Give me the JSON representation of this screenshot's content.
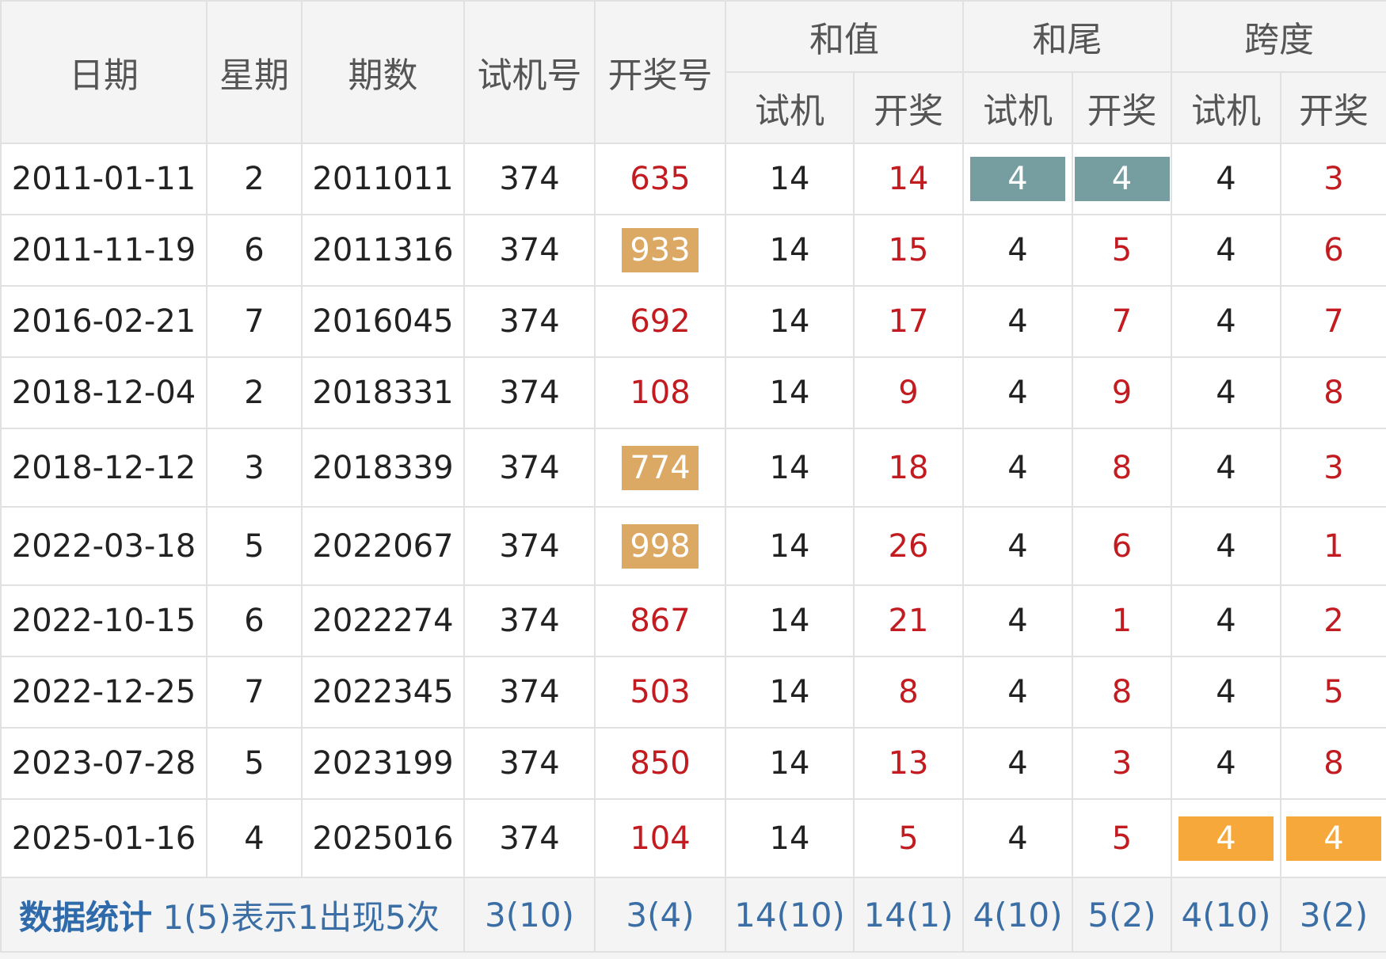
{
  "header": {
    "date": "日期",
    "weekday": "星期",
    "issue": "期数",
    "trial_number": "试机号",
    "draw_number": "开奖号",
    "sum_group": "和值",
    "tail_group": "和尾",
    "span_group": "跨度",
    "sub_trial": "试机",
    "sub_draw": "开奖"
  },
  "colors": {
    "red_text": "#c21b20",
    "tan_highlight": "#dca964",
    "teal_highlight": "#769ea0",
    "orange_highlight": "#f7a83a",
    "header_bg": "#f4f4f4",
    "stat_blue": "#2f6aaa"
  },
  "rows": [
    {
      "date": "2011-01-11",
      "weekday": "2",
      "issue": "2011011",
      "trial": "374",
      "draw": "635",
      "sum_trial": "14",
      "sum_draw": "14",
      "tail_trial": "4",
      "tail_draw": "4",
      "span_trial": "4",
      "span_draw": "3"
    },
    {
      "date": "2011-11-19",
      "weekday": "6",
      "issue": "2011316",
      "trial": "374",
      "draw": "933",
      "sum_trial": "14",
      "sum_draw": "15",
      "tail_trial": "4",
      "tail_draw": "5",
      "span_trial": "4",
      "span_draw": "6"
    },
    {
      "date": "2016-02-21",
      "weekday": "7",
      "issue": "2016045",
      "trial": "374",
      "draw": "692",
      "sum_trial": "14",
      "sum_draw": "17",
      "tail_trial": "4",
      "tail_draw": "7",
      "span_trial": "4",
      "span_draw": "7"
    },
    {
      "date": "2018-12-04",
      "weekday": "2",
      "issue": "2018331",
      "trial": "374",
      "draw": "108",
      "sum_trial": "14",
      "sum_draw": "9",
      "tail_trial": "4",
      "tail_draw": "9",
      "span_trial": "4",
      "span_draw": "8"
    },
    {
      "date": "2018-12-12",
      "weekday": "3",
      "issue": "2018339",
      "trial": "374",
      "draw": "774",
      "sum_trial": "14",
      "sum_draw": "18",
      "tail_trial": "4",
      "tail_draw": "8",
      "span_trial": "4",
      "span_draw": "3"
    },
    {
      "date": "2022-03-18",
      "weekday": "5",
      "issue": "2022067",
      "trial": "374",
      "draw": "998",
      "sum_trial": "14",
      "sum_draw": "26",
      "tail_trial": "4",
      "tail_draw": "6",
      "span_trial": "4",
      "span_draw": "1"
    },
    {
      "date": "2022-10-15",
      "weekday": "6",
      "issue": "2022274",
      "trial": "374",
      "draw": "867",
      "sum_trial": "14",
      "sum_draw": "21",
      "tail_trial": "4",
      "tail_draw": "1",
      "span_trial": "4",
      "span_draw": "2"
    },
    {
      "date": "2022-12-25",
      "weekday": "7",
      "issue": "2022345",
      "trial": "374",
      "draw": "503",
      "sum_trial": "14",
      "sum_draw": "8",
      "tail_trial": "4",
      "tail_draw": "8",
      "span_trial": "4",
      "span_draw": "5"
    },
    {
      "date": "2023-07-28",
      "weekday": "5",
      "issue": "2023199",
      "trial": "374",
      "draw": "850",
      "sum_trial": "14",
      "sum_draw": "13",
      "tail_trial": "4",
      "tail_draw": "3",
      "span_trial": "4",
      "span_draw": "8"
    },
    {
      "date": "2025-01-16",
      "weekday": "4",
      "issue": "2025016",
      "trial": "374",
      "draw": "104",
      "sum_trial": "14",
      "sum_draw": "5",
      "tail_trial": "4",
      "tail_draw": "5",
      "span_trial": "4",
      "span_draw": "4"
    }
  ],
  "footer": {
    "title": "数据统计",
    "note": " 1(5)表示1出现5次",
    "trial": "3(10)",
    "draw": "3(4)",
    "sum_trial": "14(10)",
    "sum_draw": "14(1)",
    "tail_trial": "4(10)",
    "tail_draw": "5(2)",
    "span_trial": "4(10)",
    "span_draw": "3(2)"
  }
}
